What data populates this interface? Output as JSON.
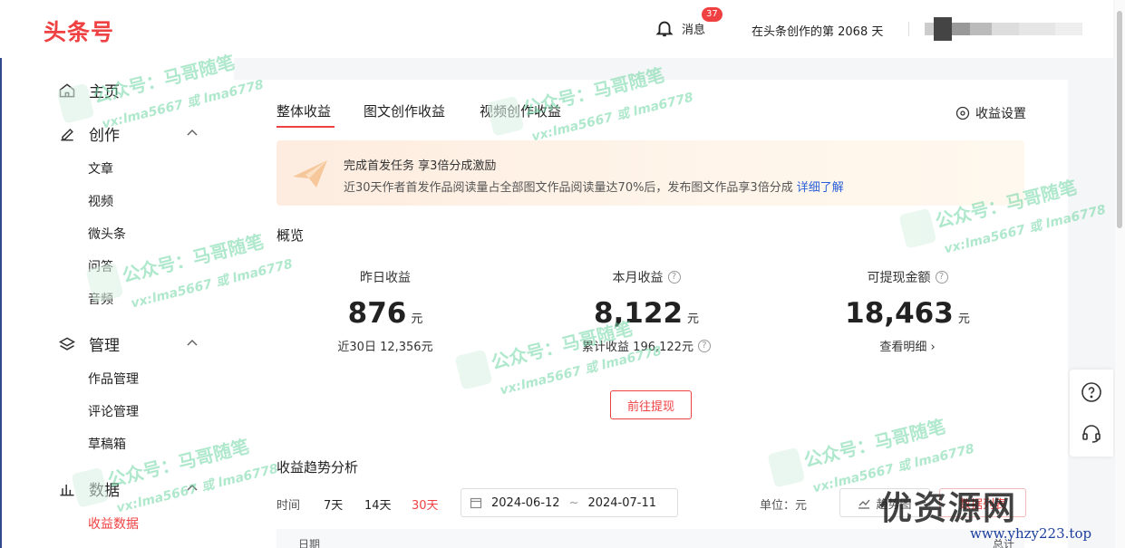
{
  "header": {
    "logo": "头条号",
    "messages_label": "消息",
    "messages_badge": "37",
    "days_text": "在头条创作的第 2068 天"
  },
  "sidebar": {
    "home": "主页",
    "create": "创作",
    "create_items": [
      "文章",
      "视频",
      "微头条",
      "问答",
      "音频"
    ],
    "manage": "管理",
    "manage_items": [
      "作品管理",
      "评论管理",
      "草稿箱"
    ],
    "data": "数据",
    "data_items": [
      "收益数据"
    ]
  },
  "tabs": [
    "整体收益",
    "图文创作收益",
    "视频创作收益"
  ],
  "settings_label": "收益设置",
  "banner": {
    "title": "完成首发任务 享3倍分成激励",
    "desc": "近30天作者首发作品阅读量占全部图文作品阅读量达70%后，发布图文作品享3倍分成",
    "link": "详细了解"
  },
  "overview": {
    "title": "概览",
    "stats": [
      {
        "label": "昨日收益",
        "value": "876",
        "unit": "元",
        "sub": "近30日 12,356元"
      },
      {
        "label": "本月收益",
        "value": "8,122",
        "unit": "元",
        "sub": "累计收益 196,122元"
      },
      {
        "label": "可提现金额",
        "value": "18,463",
        "unit": "元",
        "sub": "查看明细 ›"
      }
    ],
    "withdraw_button": "前往提现"
  },
  "trend": {
    "title": "收益趋势分析",
    "time_label": "时间",
    "ranges": [
      "7天",
      "14天",
      "30天"
    ],
    "active_range": "30天",
    "date_start": "2024-06-12",
    "date_sep": "~",
    "date_end": "2024-07-11",
    "unit_label": "单位：元",
    "trend_button": "趋势图",
    "list_button": "数据列表",
    "table_col_date": "日期",
    "table_col_total": "总计"
  },
  "watermark": {
    "line1": "公众号：马哥随笔",
    "line2": "vx:lma5667 或 lma6778",
    "corner_logo": "优资源网",
    "corner_url": "www.yhzy223.top"
  },
  "colors": {
    "brand": "#f04142",
    "link": "#2b5fd9"
  }
}
